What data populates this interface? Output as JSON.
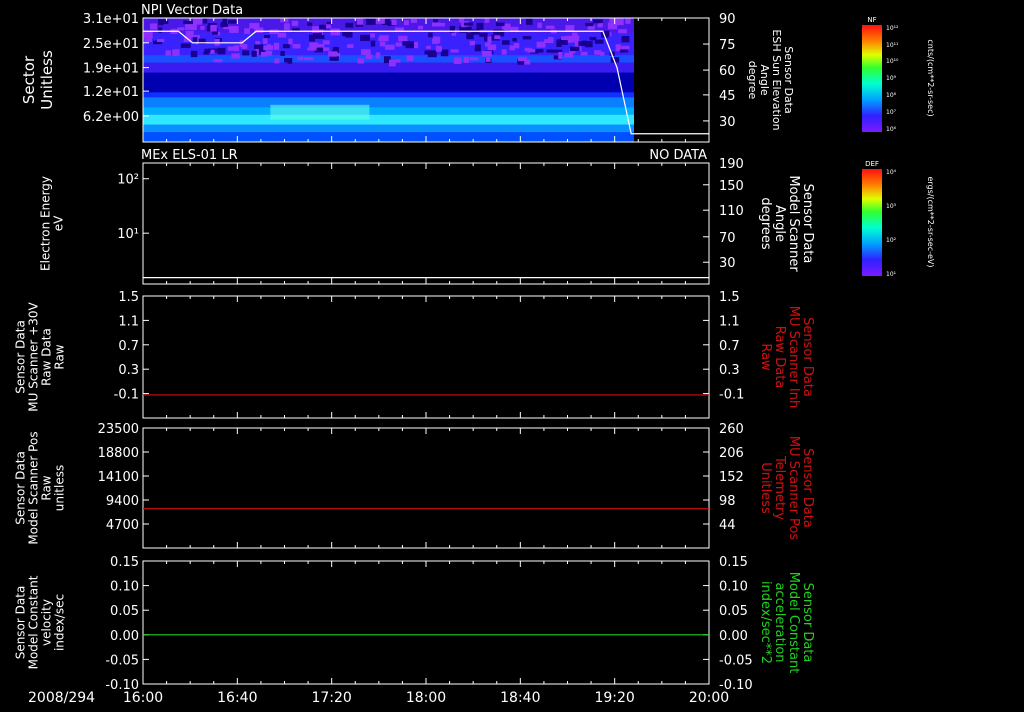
{
  "colors": {
    "background": "#000000",
    "axis": "#ffffff",
    "red": "#d01010",
    "green": "#20d020",
    "white": "#ffffff"
  },
  "time_axis": {
    "date": "2008/294",
    "ticks": [
      "16:00",
      "16:40",
      "17:20",
      "18:00",
      "18:40",
      "19:20",
      "20:00"
    ]
  },
  "colorbars": [
    {
      "title": "NF",
      "unit": "cnts/(cm**2-sr-sec)",
      "ticks": [
        "10¹²",
        "10¹¹",
        "10¹⁰",
        "10⁹",
        "10⁸",
        "10⁷",
        "10⁶"
      ]
    },
    {
      "title": "DEF",
      "unit": "ergs/(cm**2-sr-sec-eV)",
      "ticks": [
        "10⁴",
        "10³",
        "10²",
        "10¹"
      ]
    }
  ],
  "chart_data": [
    {
      "type": "heatmap",
      "title": "NPI Vector Data",
      "ylabel": [
        "Sector",
        "Unitless"
      ],
      "yticks": [
        "3.1e+01",
        "2.5e+01",
        "1.9e+01",
        "1.2e+01",
        "6.2e+00"
      ],
      "y2label": [
        "Sensor Data",
        "ESH Sun Elevation",
        "Angle",
        "degree"
      ],
      "y2ticks": [
        "90",
        "75",
        "60",
        "45",
        "30"
      ],
      "ylim2": [
        15,
        90
      ],
      "overlay": {
        "name": "ESH Sun Elevation Angle",
        "x_hours": [
          16.0,
          16.25,
          16.35,
          16.7,
          16.8,
          17.0,
          19.25,
          19.35,
          19.45,
          20.0
        ],
        "values": [
          82,
          82,
          75,
          75,
          82,
          82,
          82,
          60,
          20,
          20
        ]
      },
      "data_end_hour": 19.47
    },
    {
      "type": "line",
      "title": "MEx ELS-01 LR",
      "status": "NO DATA",
      "ylabel": [
        "Electron Energy",
        "eV"
      ],
      "yticks": [
        "10²",
        "10¹"
      ],
      "y2label": [
        "Sensor Data",
        "Model Scanner",
        "Angle",
        "degrees"
      ],
      "y2ticks": [
        "190",
        "150",
        "110",
        "70",
        "30"
      ],
      "ylim2": [
        0,
        190
      ],
      "series": [
        {
          "name": "Model Scanner Angle",
          "color": "#ffffff",
          "value": 10
        }
      ]
    },
    {
      "type": "line",
      "ylabel": [
        "Sensor Data",
        "MU Scanner +30V",
        "Raw Data",
        "Raw"
      ],
      "yticks": [
        "1.5",
        "1.1",
        "0.7",
        "0.3",
        "-0.1"
      ],
      "ylim": [
        -0.35,
        1.5
      ],
      "y2label": [
        "Sensor Data",
        "MU Scanner Inh",
        "Raw Data",
        "Raw"
      ],
      "y2ticks": [
        "1.5",
        "1.1",
        "0.7",
        "0.3",
        "-0.1"
      ],
      "series": [
        {
          "name": "MU Scanner Inh",
          "color": "#d01010",
          "value": 0.0
        }
      ]
    },
    {
      "type": "line",
      "ylabel": [
        "Sensor Data",
        "Model Scanner Pos",
        "Raw",
        "unitless"
      ],
      "yticks": [
        "23500",
        "18800",
        "14100",
        "9400",
        "4700"
      ],
      "ylim": [
        0,
        23500
      ],
      "y2label": [
        "Sensor Data",
        "MU Scanner Pos",
        "Telemetry",
        "Unitless"
      ],
      "y2ticks": [
        "260",
        "206",
        "152",
        "98",
        "44"
      ],
      "series": [
        {
          "name": "MU Scanner Pos",
          "color": "#d01010",
          "value": 7700
        }
      ]
    },
    {
      "type": "line",
      "ylabel": [
        "Sensor Data",
        "Model Constant",
        "velocity",
        "index/sec"
      ],
      "yticks": [
        "0.15",
        "0.10",
        "0.05",
        "0.00",
        "-0.05",
        "-0.10"
      ],
      "ylim": [
        -0.1,
        0.15
      ],
      "y2label": [
        "Sensor Data",
        "Model Constant",
        "acceleration",
        "index/sec**2"
      ],
      "y2ticks": [
        "0.15",
        "0.10",
        "0.05",
        "0.00",
        "-0.05",
        "-0.10"
      ],
      "series": [
        {
          "name": "Model Constant acceleration",
          "color": "#20d020",
          "value": 0.0
        }
      ]
    }
  ]
}
